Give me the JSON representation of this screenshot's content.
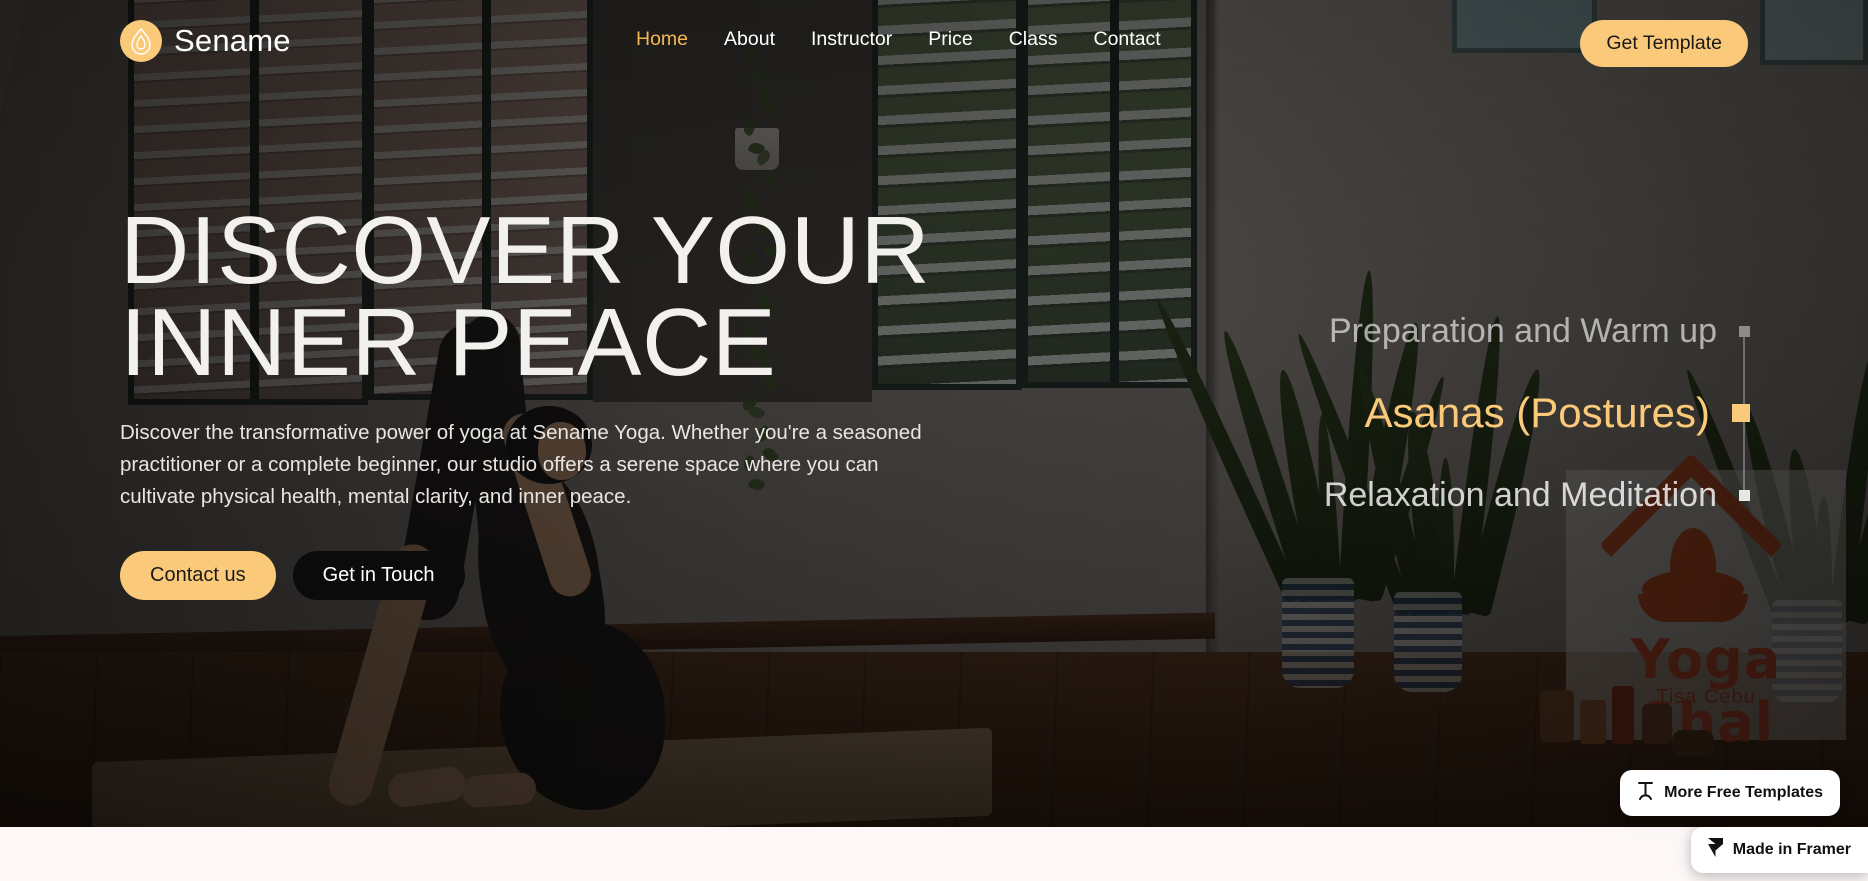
{
  "brand": {
    "name": "Sename",
    "logo_icon": "lotus-flame-icon",
    "logo_bg": "#FBC97A"
  },
  "nav": {
    "items": [
      {
        "label": "Home",
        "active": true
      },
      {
        "label": "About",
        "active": false
      },
      {
        "label": "Instructor",
        "active": false
      },
      {
        "label": "Price",
        "active": false
      },
      {
        "label": "Class",
        "active": false
      },
      {
        "label": "Contact",
        "active": false
      }
    ],
    "cta_label": "Get Template"
  },
  "hero": {
    "title_line1": "DISCOVER YOUR",
    "title_line2": "INNER PEACE",
    "subtitle": "Discover the transformative power of yoga at Sename Yoga. Whether you're a seasoned practitioner or a complete beginner, our studio offers a serene space where you can cultivate physical health, mental clarity, and inner peace.",
    "primary_button": "Contact us",
    "secondary_button": "Get in Touch"
  },
  "stepper": {
    "items": [
      {
        "label": "Preparation and Warm up",
        "state": "upcoming"
      },
      {
        "label": "Asanas (Postures)",
        "state": "active"
      },
      {
        "label": "Relaxation and Meditation",
        "state": "next"
      }
    ]
  },
  "wall_banner": {
    "title": "Yoga Shal",
    "subtitle": "Tisa Cebu"
  },
  "badges": [
    {
      "label": "More Free Templates",
      "icon": "framer-template-icon"
    },
    {
      "label": "Made in Framer",
      "icon": "framer-logo-icon"
    }
  ],
  "colors": {
    "accent": "#FBC97A",
    "accent_text": "#F5B756",
    "dark": "#0b0b0b",
    "hero_text": "#f3f1ee",
    "bottom_bg": "#FDF8F7"
  }
}
